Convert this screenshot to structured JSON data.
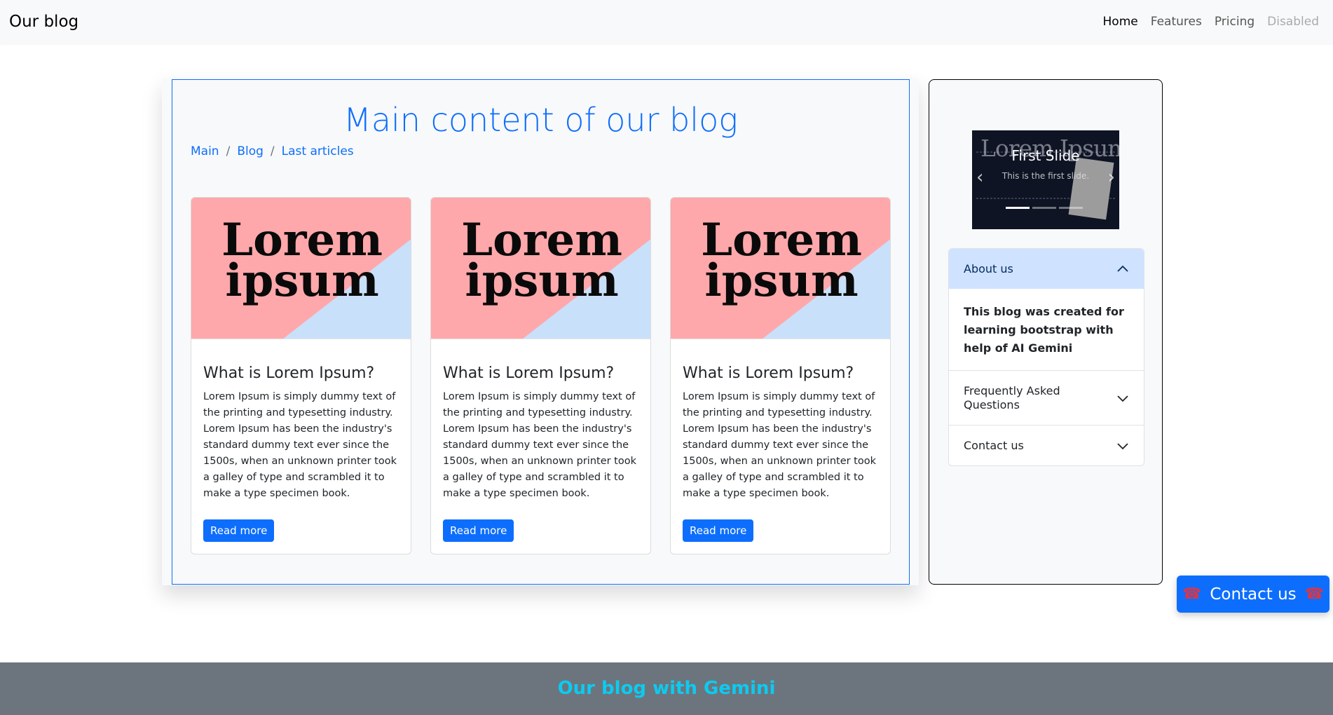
{
  "navbar": {
    "brand": "Our blog",
    "links": [
      "Home",
      "Features",
      "Pricing",
      "Disabled"
    ]
  },
  "main": {
    "title": "Main content of our blog",
    "breadcrumb": [
      "Main",
      "Blog",
      "Last articles"
    ],
    "cards": [
      {
        "image_text_1": "Lorem",
        "image_text_2": "ipsum",
        "title": "What is Lorem Ipsum?",
        "text": "Lorem Ipsum is simply dummy text of the printing and typesetting industry. Lorem Ipsum has been the industry's standard dummy text ever since the 1500s, when an unknown printer took a galley of type and scrambled it to make a type specimen book.",
        "button": "Read more"
      },
      {
        "image_text_1": "Lorem",
        "image_text_2": "ipsum",
        "title": "What is Lorem Ipsum?",
        "text": "Lorem Ipsum is simply dummy text of the printing and typesetting industry. Lorem Ipsum has been the industry's standard dummy text ever since the 1500s, when an unknown printer took a galley of type and scrambled it to make a type specimen book.",
        "button": "Read more"
      },
      {
        "image_text_1": "Lorem",
        "image_text_2": "ipsum",
        "title": "What is Lorem Ipsum?",
        "text": "Lorem Ipsum is simply dummy text of the printing and typesetting industry. Lorem Ipsum has been the industry's standard dummy text ever since the 1500s, when an unknown printer took a galley of type and scrambled it to make a type specimen book.",
        "button": "Read more"
      }
    ],
    "card_image_colors": {
      "pink": "#ffa8ab",
      "blue": "#c9e0fb"
    }
  },
  "sidebar": {
    "carousel": {
      "background_text": "Lorem Ipsum",
      "caption": "First Slide",
      "subcaption": "This is the first slide.",
      "prev_icon": "chevron-left-icon",
      "next_icon": "chevron-right-icon"
    },
    "accordion": [
      {
        "title": "About us",
        "body": "This blog was created for learning bootstrap with help of AI Gemini",
        "open": true
      },
      {
        "title": "Frequently Asked Questions",
        "open": false
      },
      {
        "title": "Contact us",
        "open": false
      }
    ]
  },
  "contact_button": {
    "label": "Contact us",
    "icon": "telephone-icon"
  },
  "footer": {
    "text": "Our blog with Gemini"
  },
  "colors": {
    "accent": "#0d6efd",
    "footer_bg": "#6c757d",
    "footer_text": "#0dcaf0",
    "accordion_open_bg": "#cfe2ff"
  }
}
